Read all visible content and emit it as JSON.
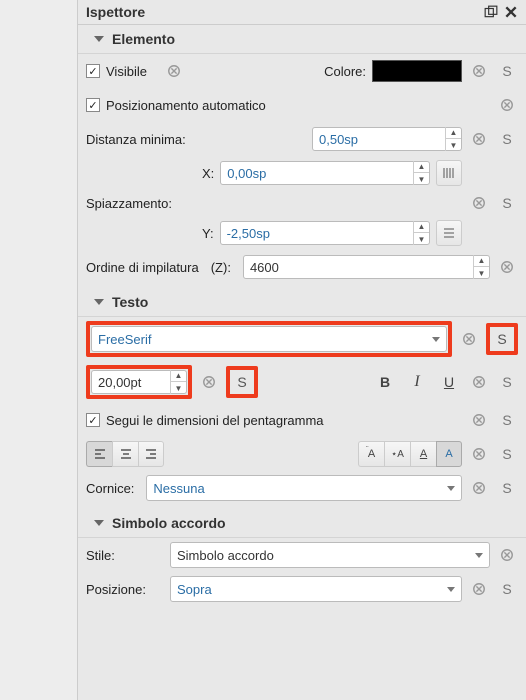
{
  "inspector": {
    "title": "Ispettore"
  },
  "elemento": {
    "title": "Elemento",
    "visible_label": "Visibile",
    "colore_label": "Colore:",
    "posauto_label": "Posizionamento automatico",
    "distmin_label": "Distanza minima:",
    "distmin_val": "0,50sp",
    "spiaz_label": "Spiazzamento:",
    "x_label": "X:",
    "x_val": "0,00sp",
    "y_label": "Y:",
    "y_val": "-2,50sp",
    "stack_label": "Ordine di impilatura",
    "z_label": "(Z):",
    "z_val": "4600"
  },
  "testo": {
    "title": "Testo",
    "font": "FreeSerif",
    "size": "20,00pt",
    "seguidim_label": "Segui le dimensioni del pentagramma",
    "cornice_label": "Cornice:",
    "cornice_val": "Nessuna"
  },
  "simbolo": {
    "title": "Simbolo accordo",
    "stile_label": "Stile:",
    "stile_val": "Simbolo accordo",
    "pos_label": "Posizione:",
    "pos_val": "Sopra"
  },
  "letters": {
    "s": "S",
    "b": "B",
    "i": "I",
    "u": "U",
    "a": "A"
  }
}
